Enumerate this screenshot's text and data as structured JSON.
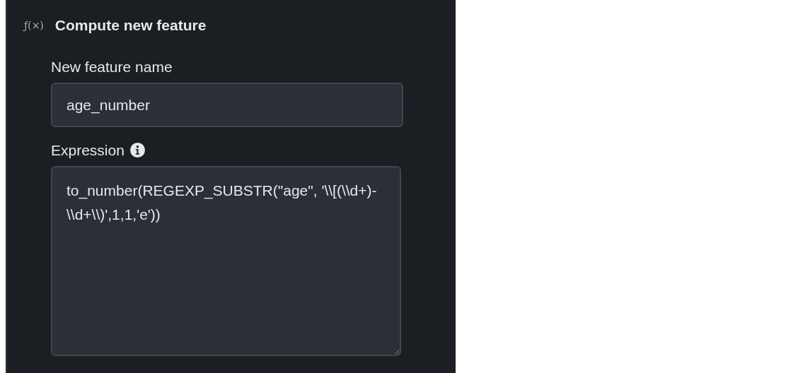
{
  "panel": {
    "icon": "ƒ(×)",
    "title": "Compute new feature"
  },
  "fields": [
    {
      "kind": "input",
      "label": "New feature name",
      "value": "age_number"
    },
    {
      "kind": "textarea",
      "label": "Expression",
      "info": true,
      "value": "to_number(REGEXP_SUBSTR(\"age\", '\\\\[(\\\\d+)-\\\\d+\\\\)',1,1,'e'))"
    }
  ]
}
